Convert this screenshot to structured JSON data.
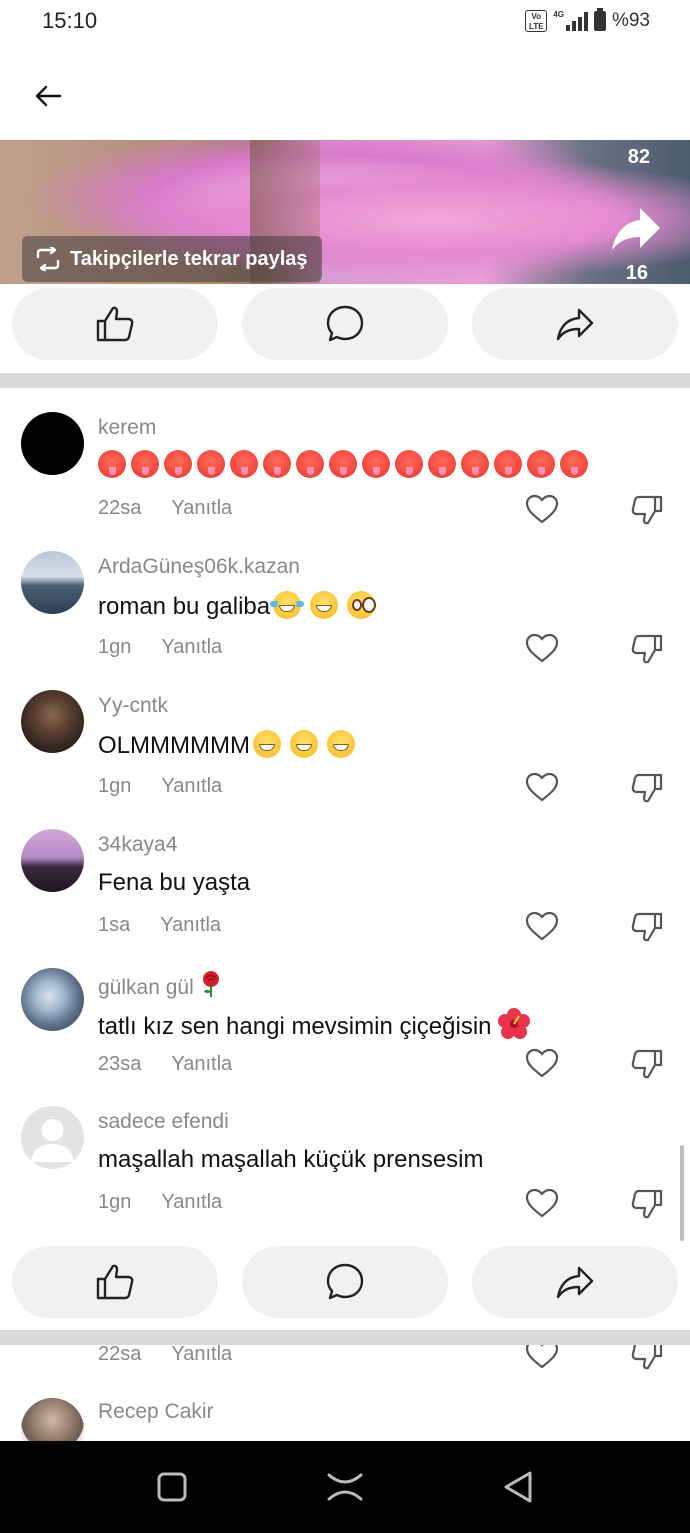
{
  "status": {
    "time": "15:10",
    "network": "4G",
    "battery": "%93"
  },
  "video": {
    "repost_label": "Takipçilerle tekrar paylaş",
    "share_count_top": "82",
    "share_count_bottom": "16"
  },
  "comments": [
    {
      "username": "kerem",
      "text": "",
      "emoji_row_count": 15,
      "time": "22sa",
      "reply": "Yanıtla"
    },
    {
      "username": "ArdaGüneş06k.kazan",
      "text": "roman bu galiba",
      "time": "1gn",
      "reply": "Yanıtla"
    },
    {
      "username": "Yy-cntk",
      "text": "OLMMMMMM",
      "time": "1gn",
      "reply": "Yanıtla"
    },
    {
      "username": "34kaya4",
      "text": "Fena bu yaşta",
      "time": "1sa",
      "reply": "Yanıtla"
    },
    {
      "username": "gülkan gül",
      "text": "tatlı kız sen hangi mevsimin çiçeğisin",
      "time": "23sa",
      "reply": "Yanıtla"
    },
    {
      "username": "sadece efendi",
      "text": "maşallah maşallah küçük prensesim",
      "time": "1gn",
      "reply": "Yanıtla"
    },
    {
      "username": "",
      "text": "",
      "time": "22sa",
      "reply": "Yanıtla"
    },
    {
      "username": "Recep Cakir",
      "text": "",
      "time": "",
      "reply": ""
    }
  ],
  "colors": {
    "accent_bg": "#f1f1f2",
    "divider": "#d9d9db",
    "meta": "#888888"
  }
}
